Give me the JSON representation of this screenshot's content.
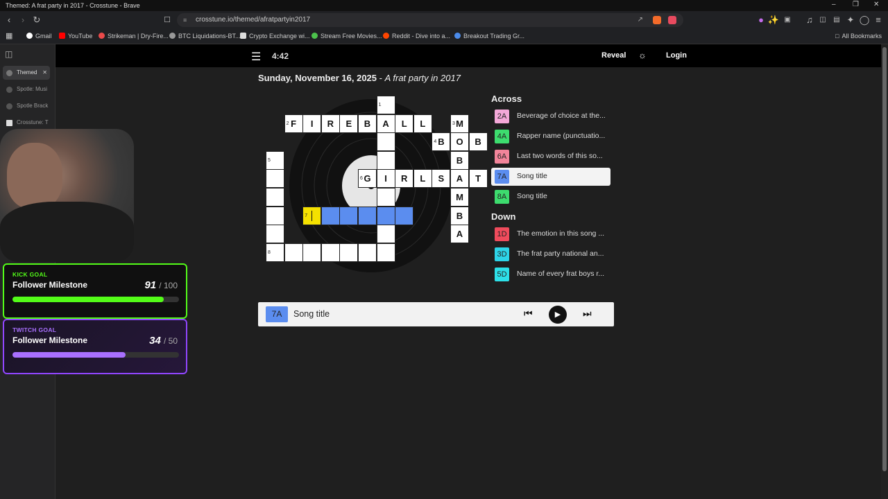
{
  "browser": {
    "window_title": "Themed: A frat party in 2017 - Crosstune - Brave",
    "url": "crosstune.io/themed/afratpartyin2017",
    "bookmarks": [
      "Gmail",
      "YouTube",
      "Strikeman | Dry-Fire...",
      "BTC Liquidations-BT...",
      "Crypto Exchange wi...",
      "Stream Free Movies...",
      "Reddit - Dive into a...",
      "Breakout Trading Gr..."
    ],
    "all_bookmarks": "All Bookmarks",
    "side_tabs": [
      "Themed",
      "Spotle: Musi",
      "Spotle Brack",
      "Crosstune: T"
    ]
  },
  "overlay": {
    "kick": {
      "kind": "KICK GOAL",
      "name": "Follower Milestone",
      "current": "91",
      "target": "/ 100",
      "progress": 0.91,
      "color": "#53fc18"
    },
    "twitch": {
      "kind": "TWITCH GOAL",
      "name": "Follower Milestone",
      "current": "34",
      "target": "/ 50",
      "progress": 0.68,
      "color": "#a970ff"
    }
  },
  "app": {
    "timer": "4:42",
    "reveal": "Reveal",
    "login": "Login",
    "date": "Sunday, November 16, 2025",
    "separator": " - ",
    "theme": "A frat party in 2017"
  },
  "grid_cells": [
    {
      "r": 0,
      "c": 6,
      "n": "1",
      "l": ""
    },
    {
      "r": 1,
      "c": 1,
      "n": "2",
      "l": "F"
    },
    {
      "r": 1,
      "c": 2,
      "n": "",
      "l": "I"
    },
    {
      "r": 1,
      "c": 3,
      "n": "",
      "l": "R"
    },
    {
      "r": 1,
      "c": 4,
      "n": "",
      "l": "E"
    },
    {
      "r": 1,
      "c": 5,
      "n": "",
      "l": "B"
    },
    {
      "r": 1,
      "c": 6,
      "n": "",
      "l": "A"
    },
    {
      "r": 1,
      "c": 7,
      "n": "",
      "l": "L"
    },
    {
      "r": 1,
      "c": 8,
      "n": "",
      "l": "L"
    },
    {
      "r": 1,
      "c": 10,
      "n": "3",
      "l": "M"
    },
    {
      "r": 2,
      "c": 6,
      "n": "",
      "l": ""
    },
    {
      "r": 2,
      "c": 9,
      "n": "4",
      "l": "B"
    },
    {
      "r": 2,
      "c": 10,
      "n": "",
      "l": "O"
    },
    {
      "r": 2,
      "c": 11,
      "n": "",
      "l": "B"
    },
    {
      "r": 3,
      "c": 0,
      "n": "5",
      "l": ""
    },
    {
      "r": 3,
      "c": 6,
      "n": "",
      "l": ""
    },
    {
      "r": 3,
      "c": 10,
      "n": "",
      "l": "B"
    },
    {
      "r": 4,
      "c": 0,
      "n": "",
      "l": ""
    },
    {
      "r": 4,
      "c": 5,
      "n": "6",
      "l": "G"
    },
    {
      "r": 4,
      "c": 6,
      "n": "",
      "l": "I"
    },
    {
      "r": 4,
      "c": 7,
      "n": "",
      "l": "R"
    },
    {
      "r": 4,
      "c": 8,
      "n": "",
      "l": "L"
    },
    {
      "r": 4,
      "c": 9,
      "n": "",
      "l": "S"
    },
    {
      "r": 4,
      "c": 10,
      "n": "",
      "l": "A"
    },
    {
      "r": 4,
      "c": 11,
      "n": "",
      "l": "T"
    },
    {
      "r": 5,
      "c": 0,
      "n": "",
      "l": ""
    },
    {
      "r": 5,
      "c": 6,
      "n": "",
      "l": ""
    },
    {
      "r": 5,
      "c": 10,
      "n": "",
      "l": "M"
    },
    {
      "r": 6,
      "c": 0,
      "n": "",
      "l": ""
    },
    {
      "r": 6,
      "c": 2,
      "n": "7",
      "l": "",
      "s": "cur"
    },
    {
      "r": 6,
      "c": 3,
      "n": "",
      "l": "",
      "s": "sel"
    },
    {
      "r": 6,
      "c": 4,
      "n": "",
      "l": "",
      "s": "sel"
    },
    {
      "r": 6,
      "c": 5,
      "n": "",
      "l": "",
      "s": "sel"
    },
    {
      "r": 6,
      "c": 6,
      "n": "",
      "l": "",
      "s": "sel"
    },
    {
      "r": 6,
      "c": 7,
      "n": "",
      "l": "",
      "s": "sel"
    },
    {
      "r": 6,
      "c": 10,
      "n": "",
      "l": "B"
    },
    {
      "r": 7,
      "c": 0,
      "n": "",
      "l": ""
    },
    {
      "r": 7,
      "c": 6,
      "n": "",
      "l": ""
    },
    {
      "r": 7,
      "c": 10,
      "n": "",
      "l": "A"
    },
    {
      "r": 8,
      "c": 0,
      "n": "8",
      "l": ""
    },
    {
      "r": 8,
      "c": 1,
      "n": "",
      "l": ""
    },
    {
      "r": 8,
      "c": 2,
      "n": "",
      "l": ""
    },
    {
      "r": 8,
      "c": 3,
      "n": "",
      "l": ""
    },
    {
      "r": 8,
      "c": 4,
      "n": "",
      "l": ""
    },
    {
      "r": 8,
      "c": 5,
      "n": "",
      "l": ""
    },
    {
      "r": 8,
      "c": 6,
      "n": "",
      "l": ""
    }
  ],
  "clues": {
    "across_heading": "Across",
    "down_heading": "Down",
    "across": [
      {
        "id": "2A",
        "text": "Beverage of choice at the...",
        "color": "#f4a8d8"
      },
      {
        "id": "4A",
        "text": "Rapper name (punctuatio...",
        "color": "#3ddc6e"
      },
      {
        "id": "6A",
        "text": "Last two words of this so...",
        "color": "#f2849a"
      },
      {
        "id": "7A",
        "text": "Song title",
        "color": "#5b8def",
        "active": true
      },
      {
        "id": "8A",
        "text": "Song title",
        "color": "#3ddc6e"
      }
    ],
    "down": [
      {
        "id": "1D",
        "text": "The emotion in this song ...",
        "color": "#ef4b5c"
      },
      {
        "id": "3D",
        "text": "The frat party national an...",
        "color": "#2dd4e8"
      },
      {
        "id": "5D",
        "text": "Name of every frat boys r...",
        "color": "#2de0e8"
      }
    ]
  },
  "player": {
    "badge": "7A",
    "badge_color": "#5b8def",
    "title": "Song title"
  }
}
